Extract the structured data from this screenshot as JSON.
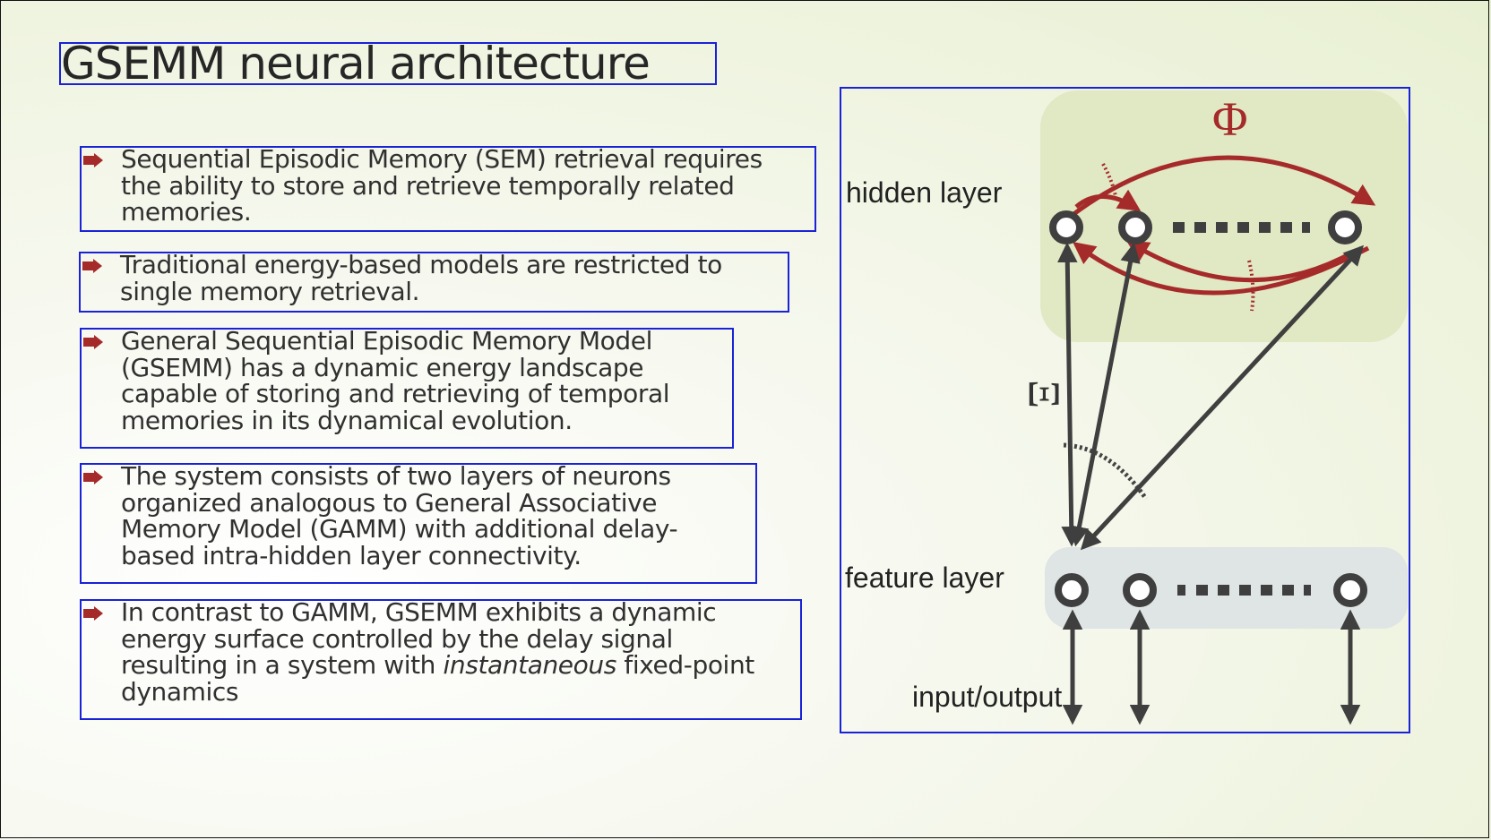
{
  "slide": {
    "title": "GSEMM neural architecture",
    "bullets": [
      {
        "lines": [
          "Sequential Episodic Memory (SEM) retrieval requires",
          "the ability to store and retrieve temporally related",
          "memories."
        ]
      },
      {
        "lines": [
          "Traditional energy-based models are restricted to",
          "single memory retrieval."
        ]
      },
      {
        "lines": [
          "General Sequential Episodic Memory Model",
          "(GSEMM) has a dynamic energy landscape",
          "capable of storing and retrieving of temporal",
          "memories in its dynamical evolution."
        ]
      },
      {
        "lines": [
          "The system consists of two layers of neurons",
          "organized analogous to General Associative",
          "Memory Model (GAMM) with additional delay-",
          "based intra-hidden layer connectivity."
        ]
      },
      {
        "lines": [
          "In contrast to GAMM, GSEMM exhibits a dynamic",
          "energy surface controlled by the delay signal"
        ],
        "line3_prefix": "resulting in a system with ",
        "line3_italic": "instantaneous",
        "line3_suffix": " fixed-point",
        "line4": "dynamics"
      }
    ]
  },
  "diagram": {
    "hidden_label": "hidden layer",
    "feature_label": "feature layer",
    "io_label": "input/output",
    "phi_symbol": "Φ",
    "xi_symbol": "Ξ"
  },
  "colors": {
    "accent_red": "#a52a2a",
    "node_dark": "#3f3f3f",
    "hidden_bg": "#e1e8c4",
    "feature_bg": "#dfe4e4",
    "frame_blue": "#1a22d8"
  }
}
